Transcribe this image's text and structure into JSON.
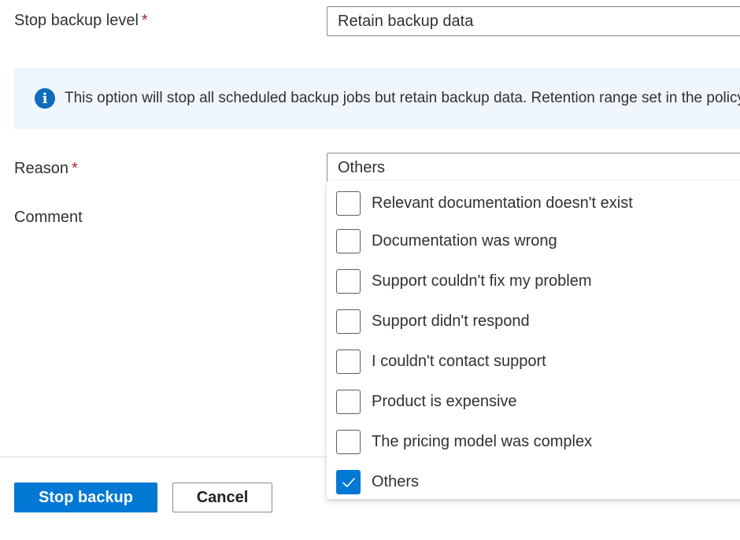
{
  "form": {
    "stop_backup_level": {
      "label": "Stop backup level",
      "required_marker": "*",
      "value": "Retain backup data"
    },
    "info_message": {
      "icon": "info-icon",
      "text": "This option will stop all scheduled backup jobs but retain backup data. Retention range set in the policy"
    },
    "reason": {
      "label": "Reason",
      "required_marker": "*",
      "value": "Others",
      "options": [
        {
          "label": "Relevant documentation doesn't exist",
          "checked": false
        },
        {
          "label": "Documentation was wrong",
          "checked": false
        },
        {
          "label": "Support couldn't fix my problem",
          "checked": false
        },
        {
          "label": "Support didn't respond",
          "checked": false
        },
        {
          "label": "I couldn't contact support",
          "checked": false
        },
        {
          "label": "Product is expensive",
          "checked": false
        },
        {
          "label": "The pricing model was complex",
          "checked": false
        },
        {
          "label": "Others",
          "checked": true
        }
      ]
    },
    "comment": {
      "label": "Comment"
    }
  },
  "footer": {
    "primary_label": "Stop backup",
    "secondary_label": "Cancel"
  },
  "colors": {
    "primary": "#0078d4",
    "required": "#a4262c",
    "info_bg": "#eff6fc",
    "info_icon": "#0f6cbd"
  }
}
